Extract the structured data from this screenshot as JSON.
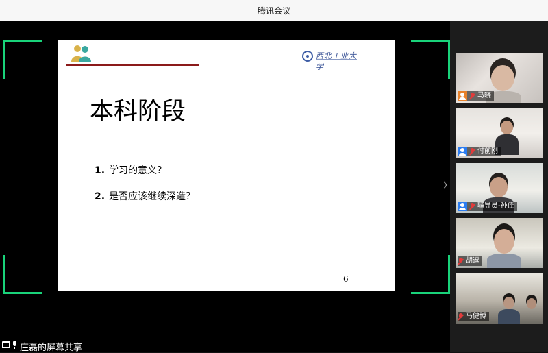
{
  "window": {
    "title": "腾讯会议"
  },
  "slide": {
    "logo_text": "西北工业大学",
    "title": "本科阶段",
    "items": [
      {
        "num": "1.",
        "text": "学习的意义？"
      },
      {
        "num": "2.",
        "text": "是否应该继续深造？"
      }
    ],
    "page_number": "6"
  },
  "participants": [
    {
      "name": "马晓",
      "avatar_color": "#e8822b",
      "avatar_icon": "user-icon"
    },
    {
      "name": "付前刚",
      "avatar_color": "#2b7df2",
      "avatar_icon": "user-icon"
    },
    {
      "name": "辅导员-孙佳",
      "avatar_color": "#2b7df2",
      "avatar_icon": "user-icon"
    },
    {
      "name": "胡逗",
      "avatar_color": "",
      "avatar_icon": ""
    },
    {
      "name": "马健博",
      "avatar_color": "",
      "avatar_icon": ""
    }
  ],
  "share_status": {
    "text": "庄磊的屏幕共享"
  },
  "colors": {
    "accent": "#19d37a",
    "slide_red": "#8b1a1a",
    "slide_blue": "#4a6aa0"
  }
}
